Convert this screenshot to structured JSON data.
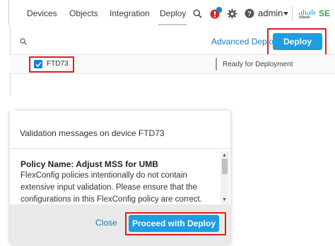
{
  "nav": {
    "items": [
      "Devices",
      "Objects",
      "Integration",
      "Deploy"
    ],
    "user": "admin",
    "badge_count": "1",
    "brand_text": "cisco",
    "brand_suffix": "SE"
  },
  "panel": {
    "advanced_deploy": "Advanced Deploy",
    "deploy_label": "Deploy",
    "device": {
      "name": "FTD73",
      "status": "Ready for Deployment",
      "checked": true
    }
  },
  "dialog": {
    "title": "Validation messages on device FTD73",
    "policy_heading": "Policy Name: Adjust MSS for UMB",
    "message_lines": [
      "FlexConfig policies intentionally do not contain",
      "extensive input validation. Please ensure that the",
      "configurations in this FlexConfig policy are correct."
    ],
    "close_label": "Close",
    "proceed_label": "Proceed with Deploy"
  },
  "colors": {
    "accent": "#1d9de2",
    "link": "#1f7ab8",
    "highlight": "#e01e1e",
    "badge": "#d9262c"
  }
}
